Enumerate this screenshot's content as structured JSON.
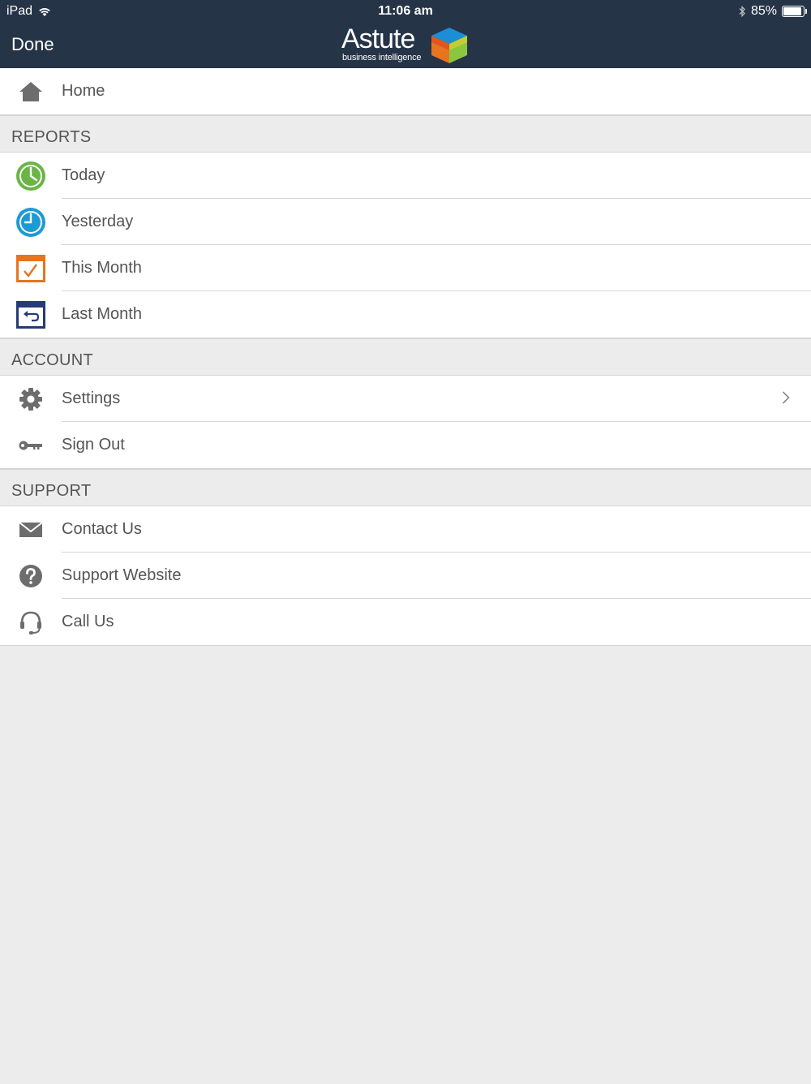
{
  "status_bar": {
    "device": "iPad",
    "time": "11:06 am",
    "battery_percent": "85%",
    "battery_level": 0.85
  },
  "nav": {
    "done_label": "Done",
    "logo_word": "Astute",
    "logo_tagline": "business intelligence"
  },
  "home": {
    "label": "Home",
    "icon": "home-icon"
  },
  "sections": {
    "reports": {
      "header": "REPORTS",
      "items": [
        {
          "label": "Today",
          "icon": "clock-green-icon"
        },
        {
          "label": "Yesterday",
          "icon": "clock-blue-icon"
        },
        {
          "label": "This Month",
          "icon": "calendar-check-icon"
        },
        {
          "label": "Last Month",
          "icon": "calendar-back-icon"
        }
      ]
    },
    "account": {
      "header": "ACCOUNT",
      "items": [
        {
          "label": "Settings",
          "icon": "gear-icon"
        },
        {
          "label": "Sign Out",
          "icon": "key-icon"
        }
      ]
    },
    "support": {
      "header": "SUPPORT",
      "items": [
        {
          "label": "Contact Us",
          "icon": "envelope-icon"
        },
        {
          "label": "Support Website",
          "icon": "question-icon"
        },
        {
          "label": "Call Us",
          "icon": "headset-icon"
        }
      ]
    }
  },
  "colors": {
    "nav_bg": "#253447",
    "background": "#ececec",
    "green": "#6ab545",
    "blue": "#1c9ad6",
    "orange": "#e8741f",
    "navy": "#253a78",
    "gray_icon": "#6d6d6d"
  }
}
